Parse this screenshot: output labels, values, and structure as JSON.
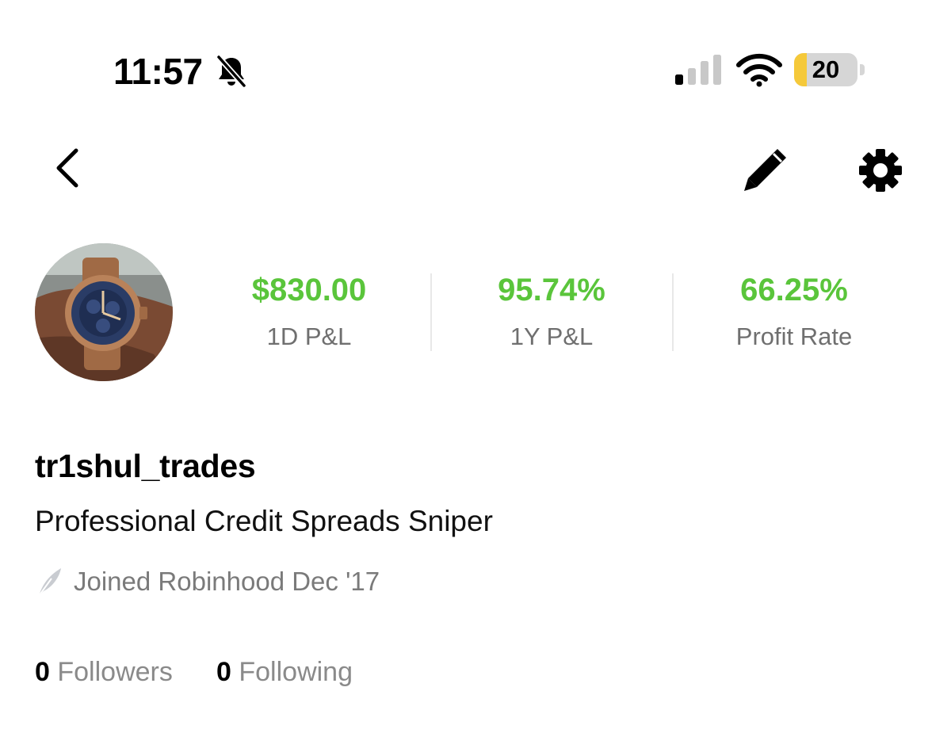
{
  "status_bar": {
    "time": "11:57",
    "battery_level": "20",
    "battery_fraction": 0.2,
    "signal_bars_active": 1,
    "signal_bars_total": 4,
    "icons": [
      "bell-slash-icon",
      "cellular-signal-icon",
      "wifi-icon",
      "battery-icon"
    ],
    "battery_fill_color": "#f5c93a"
  },
  "nav": {
    "icons": [
      "chevron-left-icon",
      "pencil-icon",
      "gear-icon"
    ]
  },
  "stats": [
    {
      "value": "$830.00",
      "label": "1D P&L"
    },
    {
      "value": "95.74%",
      "label": "1Y P&L"
    },
    {
      "value": "66.25%",
      "label": "Profit Rate"
    }
  ],
  "profile": {
    "username": "tr1shul_trades",
    "bio": "Professional Credit Spreads Sniper",
    "joined": "Joined Robinhood Dec '17",
    "followers_count": "0",
    "followers_label": "Followers",
    "following_count": "0",
    "following_label": "Following"
  },
  "colors": {
    "positive": "#5ac53b",
    "muted": "#6f6f6f"
  }
}
